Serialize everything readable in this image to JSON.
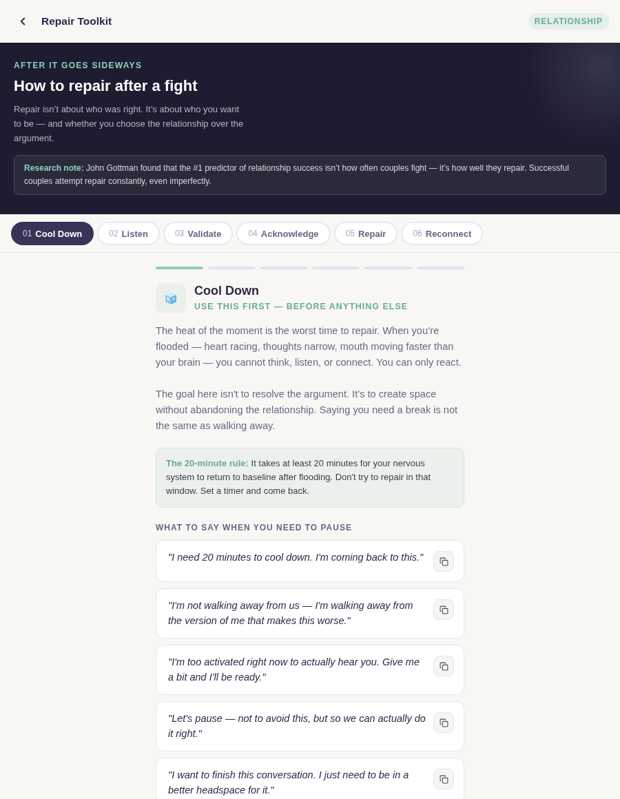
{
  "header": {
    "title": "Repair Toolkit",
    "badge": "RELATIONSHIP"
  },
  "hero": {
    "eyebrow": "AFTER IT GOES SIDEWAYS",
    "title": "How to repair after a fight",
    "description": "Repair isn’t about who was right. It’s about who you want to be — and whether you choose the relationship over the argument.",
    "note": "**Research note:** John Gottman found that the #1 predictor of relationship success isn’t how often couples fight — it’s how well they repair. Successful couples attempt repair constantly, even imperfectly."
  },
  "tabs": [
    {
      "number": "01",
      "label": "Cool Down",
      "selected": true
    },
    {
      "number": "02",
      "label": "Listen",
      "selected": false
    },
    {
      "number": "03",
      "label": "Validate",
      "selected": false
    },
    {
      "number": "04",
      "label": "Acknowledge",
      "selected": false
    },
    {
      "number": "05",
      "label": "Repair",
      "selected": false
    },
    {
      "number": "06",
      "label": "Reconnect",
      "selected": false
    }
  ],
  "step": {
    "progress": [
      {
        "done": true
      },
      {
        "done": false
      },
      {
        "done": false
      },
      {
        "done": false
      },
      {
        "done": false
      },
      {
        "done": false
      }
    ],
    "title": "Cool Down",
    "subtitle": "USE THIS FIRST — BEFORE ANYTHING ELSE",
    "paragraphs": [
      "The heat of the moment is the worst time to repair. When you’re flooded — heart racing, thoughts narrow, mouth moving faster than your brain — you cannot think, listen, or connect. You can only react.",
      "The goal here isn't to resolve the argument. It’s to create space without abandoning the relationship. Saying you need a break is not the same as walking away."
    ],
    "callout": "**The 20-minute rule:** It takes at least 20 minutes for your nervous system to return to baseline after flooding. Don't try to repair in that window. Set a timer and come back.",
    "phrases_heading": "WHAT TO SAY WHEN YOU NEED TO PAUSE",
    "phrases": [
      "\"I need 20 minutes to cool down. I'm coming back to this.\"",
      "\"I'm not walking away from us — I'm walking away from the version of me that makes this worse.\"",
      "\"I'm too activated right now to actually hear you. Give me a bit and I'll be ready.\"",
      "\"Let's pause — not to avoid this, but so we can actually do it right.\"",
      "\"I want to finish this conversation. I just need to be in a better headspace for it.\""
    ]
  }
}
